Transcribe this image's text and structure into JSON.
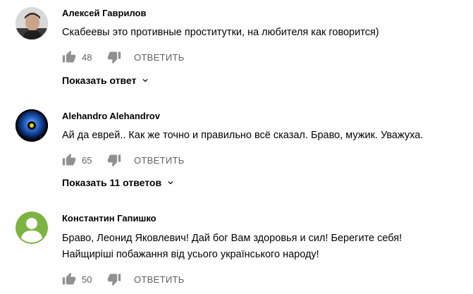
{
  "comments": [
    {
      "author": "Алексей Гаврилов",
      "text_lines": [
        "Скабеевы это противные проститутки, на любителя как говорится)"
      ],
      "likes": "48",
      "reply_label": "ОТВЕТИТЬ",
      "replies_label": "Показать ответ",
      "avatar_icon": "user-photo"
    },
    {
      "author": "Alehandro Alehandrov",
      "text_lines": [
        "Ай да еврей.. Как же точно и правильно всё сказал. Браво, мужик. Уважуха."
      ],
      "likes": "65",
      "reply_label": "ОТВЕТИТЬ",
      "replies_label": "Показать 11 ответов",
      "avatar_icon": "blue-orb-avatar"
    },
    {
      "author": "Константин Гапишко",
      "text_lines": [
        "Браво, Леонид Яковлевич! Дай бог Вам здоровья и сил! Берегите себя!",
        "Найщиріші побажання від усього українського народу!"
      ],
      "likes": "50",
      "reply_label": "ОТВЕТИТЬ",
      "avatar_icon": "default-user-avatar"
    }
  ],
  "colors": {
    "text": "#030303",
    "secondary": "#606060",
    "icon": "#909090",
    "default_avatar": "#7cb342"
  }
}
